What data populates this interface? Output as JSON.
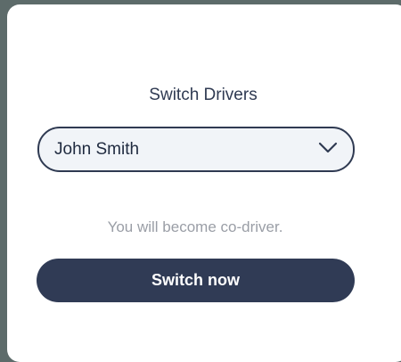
{
  "dialog": {
    "title": "Switch Drivers",
    "driver_select": {
      "selected": "John Smith",
      "icon": "chevron-down-icon"
    },
    "info_text": "You will become co-driver.",
    "switch_button_label": "Switch now"
  },
  "colors": {
    "backdrop": "#5d6b6a",
    "dialog_bg": "#ffffff",
    "primary": "#303b55",
    "select_bg": "#f1f4f8",
    "muted_text": "#9a9ea6"
  }
}
